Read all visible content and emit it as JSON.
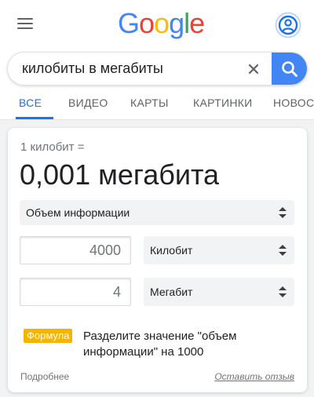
{
  "header": {
    "menu_icon": "hamburger-menu-icon",
    "logo_letters": [
      {
        "char": "G",
        "color": "#4285f4"
      },
      {
        "char": "o",
        "color": "#ea4335"
      },
      {
        "char": "o",
        "color": "#fbbc05"
      },
      {
        "char": "g",
        "color": "#4285f4"
      },
      {
        "char": "l",
        "color": "#34a853"
      },
      {
        "char": "e",
        "color": "#ea4335"
      }
    ],
    "account_icon": "account-circle-icon"
  },
  "search": {
    "value": "килобиты в мегабиты",
    "clear_icon": "close-icon",
    "submit_icon": "search-icon",
    "accent": "#4285f4"
  },
  "tabs": [
    {
      "label": "ВСЕ",
      "active": true
    },
    {
      "label": "ВИДЕО",
      "active": false
    },
    {
      "label": "КАРТЫ",
      "active": false
    },
    {
      "label": "КАРТИНКИ",
      "active": false
    },
    {
      "label": "НОВОС",
      "active": false
    }
  ],
  "converter": {
    "from_text": "1 килобит =",
    "result_text": "0,001 мегабита",
    "category": "Объем информации",
    "from_value": "4000",
    "from_unit": "Килобит",
    "to_value": "4",
    "to_unit": "Мегабит",
    "formula_badge": "Формула",
    "formula_text": "Разделите значение \"объем информации\" на 1000",
    "badge_color": "#f4b400",
    "more_link": "Подробнее",
    "feedback_link": "Оставить отзыв"
  }
}
